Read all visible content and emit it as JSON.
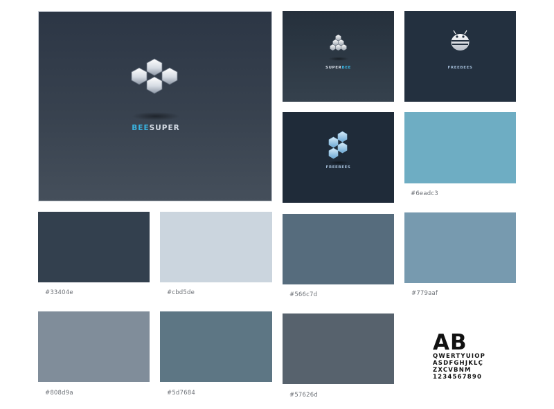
{
  "logos": {
    "main": {
      "name_part1": "BEE",
      "name_part2": "SUPER"
    },
    "small_1": {
      "name_part1": "SUPER",
      "name_part2": "BEE"
    },
    "small_2": {
      "name": "FREEBEES"
    },
    "small_3": {
      "name": "FREEBEES"
    }
  },
  "swatches": [
    {
      "hex": "#6eadc3",
      "label": "#6eadc3"
    },
    {
      "hex": "#33404e",
      "label": "#33404e"
    },
    {
      "hex": "#cbd5de",
      "label": "#cbd5de"
    },
    {
      "hex": "#566c7d",
      "label": "#566c7d"
    },
    {
      "hex": "#779aaf",
      "label": "#779aaf"
    },
    {
      "hex": "#808d9a",
      "label": "#808d9a"
    },
    {
      "hex": "#5d7684",
      "label": "#5d7684"
    },
    {
      "hex": "#57626d",
      "label": "#57626d"
    }
  ],
  "typography": {
    "sample_big": "AB",
    "line_1": "QWERTYUIOP",
    "line_2": "ASDFGHJKLÇ",
    "line_3": "ZXCVBNM",
    "line_4": "1234567890"
  },
  "colors": {
    "accent": "#3ab3e0",
    "wordmark_light": "#d6dde6"
  }
}
